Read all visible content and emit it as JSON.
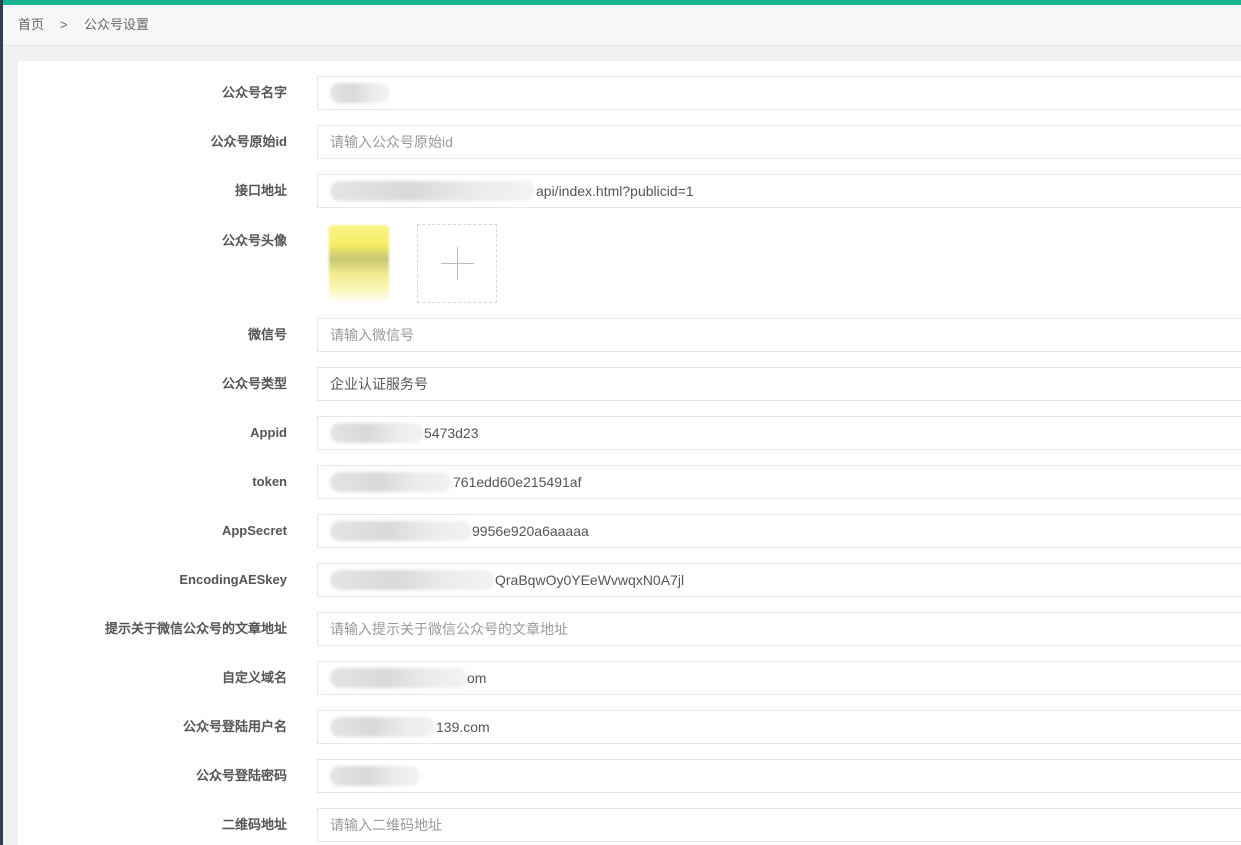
{
  "colors": {
    "accent": "#1ab394",
    "sidebar": "#2f4050"
  },
  "breadcrumb": {
    "home": "首页",
    "separator": ">",
    "current": "公众号设置"
  },
  "form": {
    "name": {
      "label": "公众号名字",
      "value": "",
      "placeholder": ""
    },
    "original_id": {
      "label": "公众号原始id",
      "value": "",
      "placeholder": "请输入公众号原始id"
    },
    "api_url": {
      "label": "接口地址",
      "value": "api/index.html?publicid=1"
    },
    "avatar": {
      "label": "公众号头像",
      "upload_icon": "plus-icon"
    },
    "wechat_id": {
      "label": "微信号",
      "value": "",
      "placeholder": "请输入微信号"
    },
    "account_type": {
      "label": "公众号类型",
      "value": "企业认证服务号"
    },
    "appid": {
      "label": "Appid",
      "value": "5473d23"
    },
    "token": {
      "label": "token",
      "value": "761edd60e215491af"
    },
    "app_secret": {
      "label": "AppSecret",
      "value": "9956e920a6aaaaa"
    },
    "encoding_aes_key": {
      "label": "EncodingAESkey",
      "value": "QraBqwOy0YEeWvwqxN0A7jl"
    },
    "guide_url": {
      "label": "提示关于微信公众号的文章地址",
      "value": "",
      "placeholder": "请输入提示关于微信公众号的文章地址"
    },
    "domain": {
      "label": "自定义域名",
      "value": "om"
    },
    "login_user": {
      "label": "公众号登陆用户名",
      "value": "139.com"
    },
    "login_password": {
      "label": "公众号登陆密码",
      "value": ""
    },
    "qrcode_url": {
      "label": "二维码地址",
      "value": "",
      "placeholder": "请输入二维码地址"
    }
  }
}
